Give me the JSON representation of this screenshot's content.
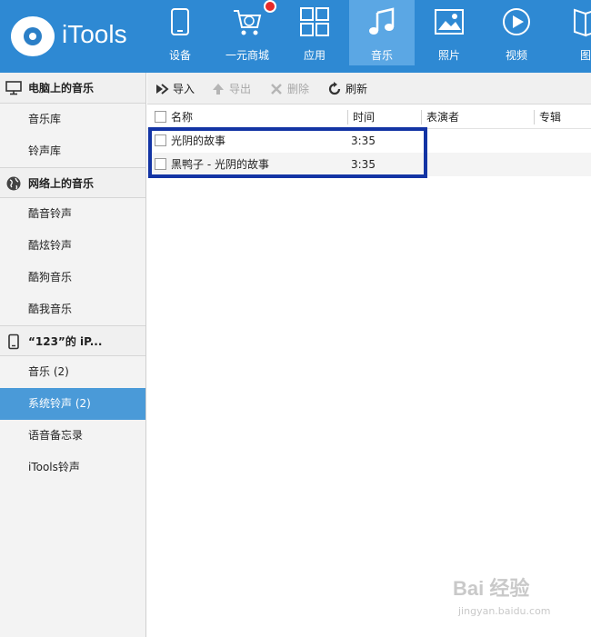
{
  "app": {
    "title": "iTools"
  },
  "nav": {
    "items": [
      {
        "label": "设备",
        "icon": "device-icon"
      },
      {
        "label": "一元商城",
        "icon": "cart-icon"
      },
      {
        "label": "应用",
        "icon": "apps-icon"
      },
      {
        "label": "音乐",
        "icon": "music-icon"
      },
      {
        "label": "照片",
        "icon": "photo-icon"
      },
      {
        "label": "视频",
        "icon": "video-icon"
      },
      {
        "label": "图书",
        "icon": "book-icon"
      }
    ],
    "active": "音乐"
  },
  "sidebar": {
    "groups": [
      {
        "title": "电脑上的音乐",
        "icon": "monitor-icon",
        "items": [
          "音乐库",
          "铃声库"
        ]
      },
      {
        "title": "网络上的音乐",
        "icon": "globe-icon",
        "items": [
          "酷音铃声",
          "酷炫铃声",
          "酷狗音乐",
          "酷我音乐"
        ]
      },
      {
        "title": "“123”的 iP...",
        "icon": "phone-icon",
        "items": [
          "音乐 (2)",
          "系统铃声 (2)",
          "语音备忘录",
          "iTools铃声"
        ]
      }
    ],
    "selected": "系统铃声 (2)"
  },
  "toolbar": {
    "import_label": "导入",
    "export_label": "导出",
    "delete_label": "删除",
    "refresh_label": "刷新"
  },
  "table": {
    "columns": [
      "名称",
      "时间",
      "表演者",
      "专辑"
    ],
    "rows": [
      {
        "name": "光阴的故事",
        "time": "3:35",
        "artist": "",
        "album": ""
      },
      {
        "name": "黑鸭子 - 光阴的故事",
        "time": "3:35",
        "artist": "",
        "album": ""
      }
    ]
  },
  "watermark": {
    "brand": "Bai 经验",
    "url": "jingyan.baidu.com"
  },
  "colors": {
    "header": "#2e89d3",
    "active_nav": "#5ba7e4",
    "selected_item": "#4a9ad8",
    "highlight_border": "#1334a4"
  }
}
